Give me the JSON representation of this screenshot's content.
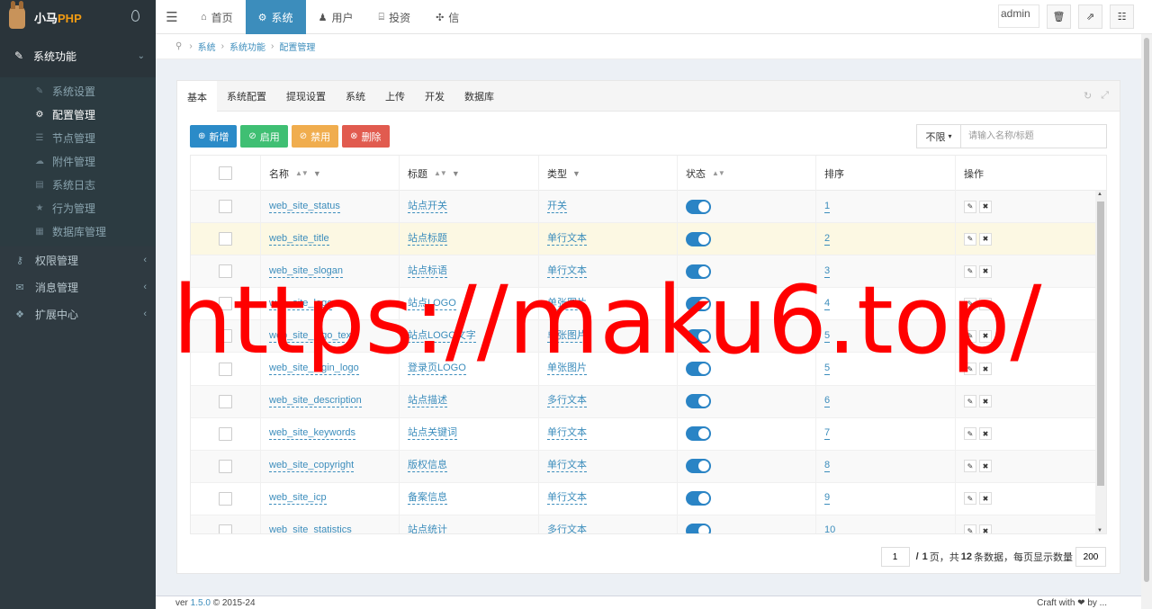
{
  "app": {
    "brand_cn": "小马",
    "brand_php": "PHP"
  },
  "sidebar": {
    "group_title": "系统功能",
    "sub_items": [
      {
        "label": "系统设置",
        "icon": "wrench-icon",
        "glyph": "✎",
        "active": false
      },
      {
        "label": "配置管理",
        "icon": "cogs-icon",
        "glyph": "⚙",
        "active": true
      },
      {
        "label": "节点管理",
        "icon": "list-icon",
        "glyph": "☰",
        "active": false
      },
      {
        "label": "附件管理",
        "icon": "cloud-upload-icon",
        "glyph": "☁",
        "active": false
      },
      {
        "label": "系统日志",
        "icon": "book-icon",
        "glyph": "▤",
        "active": false
      },
      {
        "label": "行为管理",
        "icon": "star-icon",
        "glyph": "★",
        "active": false
      },
      {
        "label": "数据库管理",
        "icon": "database-icon",
        "glyph": "▦",
        "active": false
      }
    ],
    "menus": [
      {
        "label": "权限管理",
        "icon": "key-icon",
        "glyph": "⚷"
      },
      {
        "label": "消息管理",
        "icon": "comments-icon",
        "glyph": "✉"
      },
      {
        "label": "扩展中心",
        "icon": "cubes-icon",
        "glyph": "❖"
      }
    ]
  },
  "topnav": {
    "tabs": [
      {
        "label": "首页",
        "icon": "home-icon",
        "glyph": "⌂",
        "active": false
      },
      {
        "label": "系统",
        "icon": "gear-icon",
        "glyph": "⚙",
        "active": true
      },
      {
        "label": "用户",
        "icon": "user-icon",
        "glyph": "♟",
        "active": false
      },
      {
        "label": "投资",
        "icon": "bank-icon",
        "glyph": "⌸",
        "active": false
      },
      {
        "label": "信",
        "icon": "connectdevelop-icon",
        "glyph": "✣",
        "active": false
      }
    ],
    "avatar_alt": "admin"
  },
  "breadcrumb": [
    "系统",
    "系统功能",
    "配置管理"
  ],
  "panel": {
    "tabs": [
      "基本",
      "系统配置",
      "提现设置",
      "系统",
      "上传",
      "开发",
      "数据库"
    ],
    "active_tab": "基本"
  },
  "toolbar": {
    "add": "新增",
    "enable": "启用",
    "disable": "禁用",
    "delete": "删除"
  },
  "search": {
    "dropdown": "不限",
    "placeholder": "请输入名称/标题"
  },
  "table": {
    "headers": [
      "名称",
      "标题",
      "类型",
      "状态",
      "排序",
      "操作"
    ],
    "rows": [
      {
        "name": "web_site_status",
        "title": "站点开关",
        "type": "开关",
        "status": true,
        "sort": "1"
      },
      {
        "name": "web_site_title",
        "title": "站点标题",
        "type": "单行文本",
        "status": true,
        "sort": "2"
      },
      {
        "name": "web_site_slogan",
        "title": "站点标语",
        "type": "单行文本",
        "status": true,
        "sort": "3"
      },
      {
        "name": "web_site_logo",
        "title": "站点LOGO",
        "type": "单张图片",
        "status": true,
        "sort": "4"
      },
      {
        "name": "web_site_logo_text",
        "title": "站点LOGO文字",
        "type": "单张图片",
        "status": true,
        "sort": "5"
      },
      {
        "name": "web_site_login_logo",
        "title": "登录页LOGO",
        "type": "单张图片",
        "status": true,
        "sort": "5"
      },
      {
        "name": "web_site_description",
        "title": "站点描述",
        "type": "多行文本",
        "status": true,
        "sort": "6"
      },
      {
        "name": "web_site_keywords",
        "title": "站点关键词",
        "type": "单行文本",
        "status": true,
        "sort": "7"
      },
      {
        "name": "web_site_copyright",
        "title": "版权信息",
        "type": "单行文本",
        "status": true,
        "sort": "8"
      },
      {
        "name": "web_site_icp",
        "title": "备案信息",
        "type": "单行文本",
        "status": true,
        "sort": "9"
      },
      {
        "name": "web_site_statistics",
        "title": "站点统计",
        "type": "多行文本",
        "status": true,
        "sort": "10"
      }
    ],
    "highlight_row": 1
  },
  "pager": {
    "page": "1",
    "sep": "/",
    "total_pages": "1",
    "text_pages": "页，共",
    "total_count": "12",
    "text_rows": "条数据，每页显示数量",
    "page_size": "200"
  },
  "footer": {
    "left": "ver ",
    "version": "1.5.0",
    "year": "© 2015-24",
    "right": "Craft with ❤ by ..."
  },
  "watermark": "https://maku6.top/"
}
